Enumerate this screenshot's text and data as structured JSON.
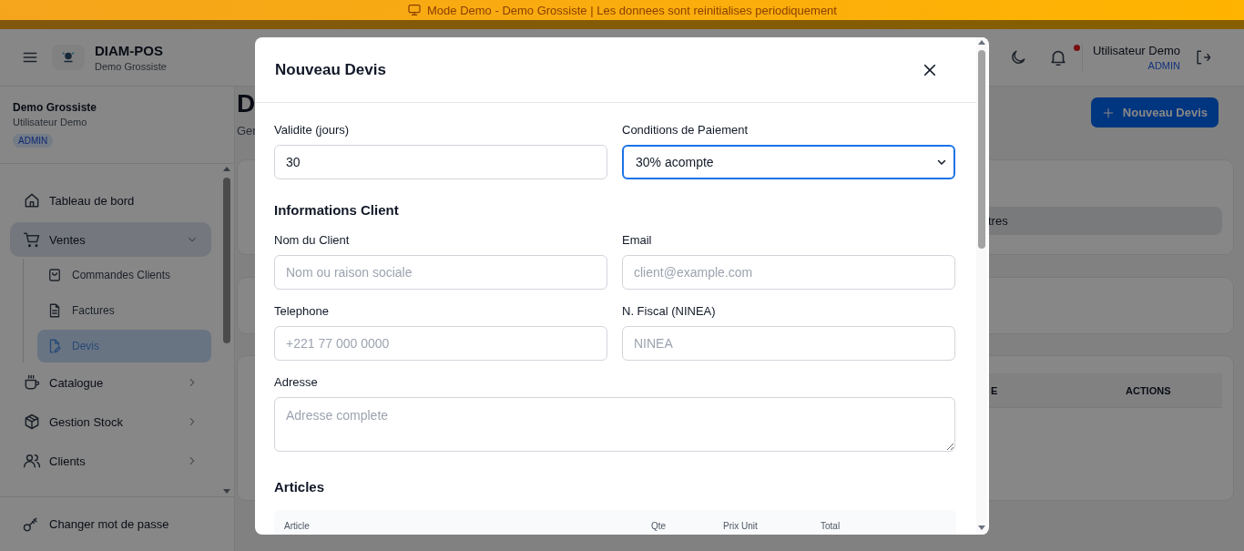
{
  "demo_banner": {
    "text": "Mode Demo - Demo Grossiste | Les donnees sont reinitialises periodiquement"
  },
  "header": {
    "app_name": "DIAM-POS",
    "company": "Demo Grossiste",
    "notifications_unread": true,
    "user_name": "Utilisateur Demo",
    "user_role": "ADMIN"
  },
  "sidebar": {
    "company": "Demo Grossiste",
    "user": "Utilisateur Demo",
    "role": "ADMIN",
    "items": [
      {
        "label": "Tableau de bord",
        "kind": "link",
        "selected": false
      },
      {
        "label": "Ventes",
        "kind": "group",
        "selected": true,
        "expanded": true,
        "children": [
          {
            "label": "Commandes Clients",
            "selected": false
          },
          {
            "label": "Factures",
            "selected": false
          },
          {
            "label": "Devis",
            "selected": true
          }
        ]
      },
      {
        "label": "Catalogue",
        "kind": "group",
        "selected": false,
        "expanded": false
      },
      {
        "label": "Gestion Stock",
        "kind": "group",
        "selected": false,
        "expanded": false
      },
      {
        "label": "Clients",
        "kind": "group",
        "selected": false,
        "expanded": false
      }
    ],
    "footer_item": "Changer mot de passe"
  },
  "page": {
    "title": "D",
    "subtitle": "Ger",
    "new_button": "Nouveau Devis",
    "filter_tab": "tres",
    "table_columns": [
      "E",
      "ACTIONS"
    ]
  },
  "modal": {
    "title": "Nouveau Devis",
    "terms_fields": [
      {
        "label": "Validite (jours)",
        "kind": "input",
        "value": "30",
        "focused": false
      },
      {
        "label": "Conditions de Paiement",
        "kind": "select",
        "value": "30% acompte",
        "focused": true
      }
    ],
    "client_heading": "Informations Client",
    "client_fields": [
      {
        "label": "Nom du Client",
        "kind": "input",
        "placeholder": "Nom ou raison sociale",
        "focused": false
      },
      {
        "label": "Email",
        "kind": "input",
        "placeholder": "client@example.com",
        "focused": false
      },
      {
        "label": "Telephone",
        "kind": "input",
        "placeholder": "+221 77 000 0000",
        "focused": false
      },
      {
        "label": "N. Fiscal (NINEA)",
        "kind": "input",
        "placeholder": "NINEA",
        "focused": false
      },
      {
        "label": "Adresse",
        "kind": "textarea",
        "placeholder": "Adresse complete",
        "focused": false
      }
    ],
    "articles_heading": "Articles",
    "articles_columns": [
      "Article",
      "Qte",
      "Prix Unit",
      "Total"
    ]
  }
}
